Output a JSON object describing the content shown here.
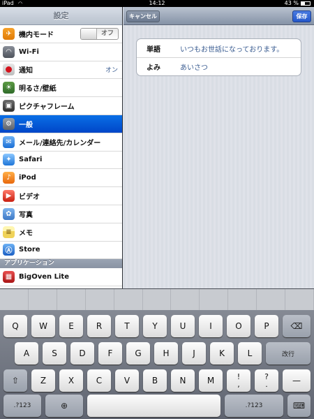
{
  "status_bar": {
    "device": "iPad",
    "time": "14:12",
    "battery": "43 %",
    "battery_level": 0.43
  },
  "sidebar": {
    "title": "設定",
    "items": [
      {
        "label": "機内モード",
        "icon": "airplane-icon",
        "toggle": "オフ"
      },
      {
        "label": "Wi-Fi",
        "icon": "wifi-icon"
      },
      {
        "label": "通知",
        "icon": "notifications-icon",
        "value": "オン"
      },
      {
        "label": "明るさ/壁紙",
        "icon": "brightness-icon"
      },
      {
        "label": "ピクチャフレーム",
        "icon": "picture-frame-icon"
      },
      {
        "label": "一般",
        "icon": "general-gear-icon",
        "selected": true
      },
      {
        "label": "メール/連絡先/カレンダー",
        "icon": "mail-icon"
      },
      {
        "label": "Safari",
        "icon": "safari-icon"
      },
      {
        "label": "iPod",
        "icon": "ipod-icon"
      },
      {
        "label": "ビデオ",
        "icon": "video-icon"
      },
      {
        "label": "写真",
        "icon": "photos-icon"
      },
      {
        "label": "メモ",
        "icon": "notes-icon"
      },
      {
        "label": "Store",
        "icon": "store-icon"
      }
    ],
    "section_header": "アプリケーション",
    "apps": [
      {
        "label": "BigOven Lite",
        "icon": "bigoven-icon"
      }
    ]
  },
  "detail": {
    "cancel_label": "キャンセル",
    "save_label": "保存",
    "fields": [
      {
        "label": "単語",
        "value": "いつもお世話になっております。"
      },
      {
        "label": "よみ",
        "value": "あいさつ"
      }
    ]
  },
  "keyboard": {
    "row1": [
      "Q",
      "W",
      "E",
      "R",
      "T",
      "Y",
      "U",
      "I",
      "O",
      "P"
    ],
    "row2": [
      "A",
      "S",
      "D",
      "F",
      "G",
      "H",
      "J",
      "K",
      "L"
    ],
    "row3": [
      "Z",
      "X",
      "C",
      "V",
      "B",
      "N",
      "M"
    ],
    "return_label": "改行",
    "numbers_label": ".?123",
    "punct_top": [
      "!",
      "?"
    ],
    "punct_bottom": [
      ",",
      "."
    ]
  }
}
